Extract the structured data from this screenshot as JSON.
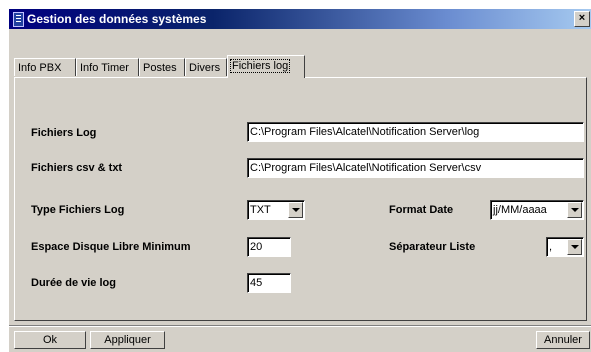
{
  "window": {
    "title": "Gestion des données systèmes",
    "close_label": "×"
  },
  "tabs": [
    {
      "label": "Info PBX",
      "active": false
    },
    {
      "label": "Info Timer",
      "active": false
    },
    {
      "label": "Postes",
      "active": false
    },
    {
      "label": "Divers",
      "active": false
    },
    {
      "label": "Fichiers log",
      "active": true
    }
  ],
  "form": {
    "fichiers_log_label": "Fichiers Log",
    "fichiers_log_value": "C:\\Program Files\\Alcatel\\Notification Server\\log",
    "fichiers_csv_label": "Fichiers csv & txt",
    "fichiers_csv_value": "C:\\Program Files\\Alcatel\\Notification Server\\csv",
    "type_label": "Type Fichiers Log",
    "type_value": "TXT",
    "format_date_label": "Format Date",
    "format_date_value": "jj/MM/aaaa",
    "espace_label": "Espace Disque Libre Minimum",
    "espace_value": "20",
    "separateur_label": "Séparateur Liste",
    "separateur_value": ",",
    "duree_label": "Durée de vie log",
    "duree_value": "45"
  },
  "buttons": {
    "ok": "Ok",
    "appliquer": "Appliquer",
    "annuler": "Annuler"
  }
}
